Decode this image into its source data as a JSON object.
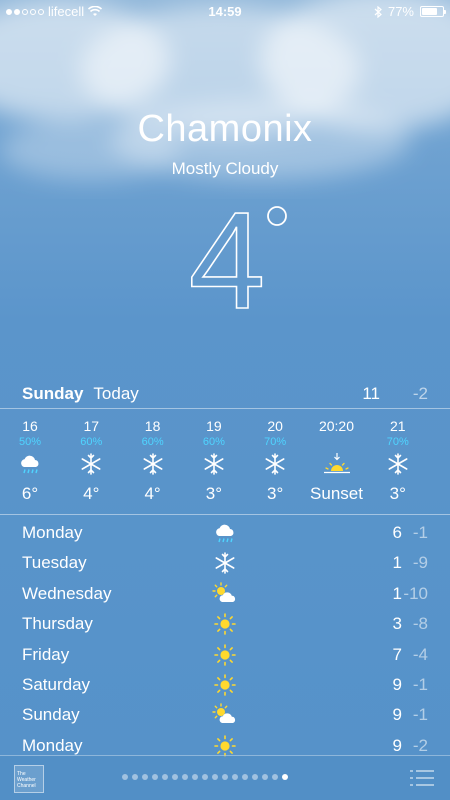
{
  "status": {
    "carrier": "lifecell",
    "time": "14:59",
    "battery": "77%",
    "battery_level": 0.77,
    "signal_bars": 2,
    "signal_total": 5
  },
  "location": {
    "city": "Chamonix",
    "condition": "Mostly Cloudy",
    "temperature": "4"
  },
  "today": {
    "day": "Sunday",
    "label": "Today",
    "high": "11",
    "low": "-2"
  },
  "hourly": [
    {
      "time": "16",
      "pop": "50%",
      "icon": "rain-cloud-icon",
      "temp": "6°"
    },
    {
      "time": "17",
      "pop": "60%",
      "icon": "snowflake-icon",
      "temp": "4°"
    },
    {
      "time": "18",
      "pop": "60%",
      "icon": "snowflake-icon",
      "temp": "4°"
    },
    {
      "time": "19",
      "pop": "60%",
      "icon": "snowflake-icon",
      "temp": "3°"
    },
    {
      "time": "20",
      "pop": "70%",
      "icon": "snowflake-icon",
      "temp": "3°"
    },
    {
      "time": "20:20",
      "pop": "",
      "icon": "sunset-icon",
      "temp": "Sunset"
    },
    {
      "time": "21",
      "pop": "70%",
      "icon": "snowflake-icon",
      "temp": "3°"
    }
  ],
  "daily": [
    {
      "day": "Monday",
      "icon": "rain-cloud-icon",
      "high": "6",
      "low": "-1"
    },
    {
      "day": "Tuesday",
      "icon": "snowflake-icon",
      "high": "1",
      "low": "-9"
    },
    {
      "day": "Wednesday",
      "icon": "partly-sunny-icon",
      "high": "1",
      "low": "-10"
    },
    {
      "day": "Thursday",
      "icon": "sun-icon",
      "high": "3",
      "low": "-8"
    },
    {
      "day": "Friday",
      "icon": "sun-icon",
      "high": "7",
      "low": "-4"
    },
    {
      "day": "Saturday",
      "icon": "sun-icon",
      "high": "9",
      "low": "-1"
    },
    {
      "day": "Sunday",
      "icon": "partly-sunny-icon",
      "high": "9",
      "low": "-1"
    },
    {
      "day": "Monday",
      "icon": "sun-icon",
      "high": "9",
      "low": "-2"
    }
  ],
  "footer": {
    "logo_text": "The Weather Channel",
    "pages_total": 17,
    "active_page": 17
  },
  "colors": {
    "precip": "#4fd4ff",
    "sun": "#ffd92e"
  }
}
